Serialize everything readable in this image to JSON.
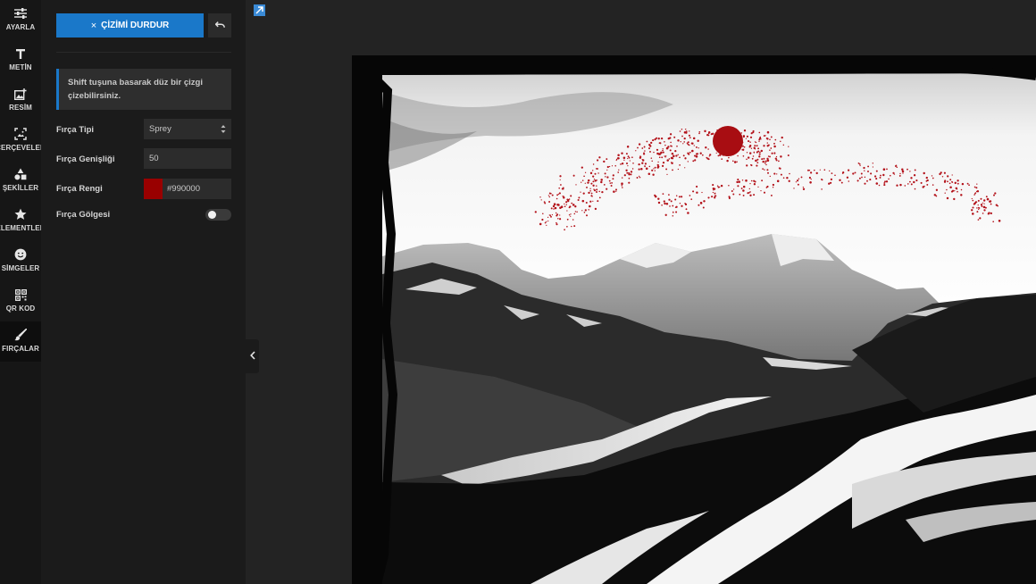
{
  "rail": {
    "items": [
      {
        "label": "AYARLA",
        "icon": "sliders-icon"
      },
      {
        "label": "METİN",
        "icon": "text-icon"
      },
      {
        "label": "RESİM",
        "icon": "image-add-icon"
      },
      {
        "label": "ÇERÇEVELER",
        "icon": "frame-icon"
      },
      {
        "label": "ŞEKİLLER",
        "icon": "shapes-icon"
      },
      {
        "label": "ELEMENTLER",
        "icon": "star-icon"
      },
      {
        "label": "SİMGELER",
        "icon": "smiley-icon"
      },
      {
        "label": "QR KOD",
        "icon": "qr-code-icon"
      },
      {
        "label": "FIRÇALAR",
        "icon": "brush-icon",
        "active": true
      }
    ]
  },
  "panel": {
    "stop_button": "ÇİZİMİ DURDUR",
    "stop_icon": "×",
    "info_text": "Shift tuşuna basarak düz bir çizgi çizebilirsiniz.",
    "brush_type_label": "Fırça Tipi",
    "brush_type_value": "Sprey",
    "brush_width_label": "Fırça Genişliği",
    "brush_width_value": "50",
    "brush_color_label": "Fırça Rengi",
    "brush_color_value": "#990000",
    "brush_shadow_label": "Fırça Gölgesi",
    "brush_shadow_on": false
  },
  "colors": {
    "accent": "#1a78c9",
    "brush": "#990000",
    "spray": "#b3121a"
  }
}
